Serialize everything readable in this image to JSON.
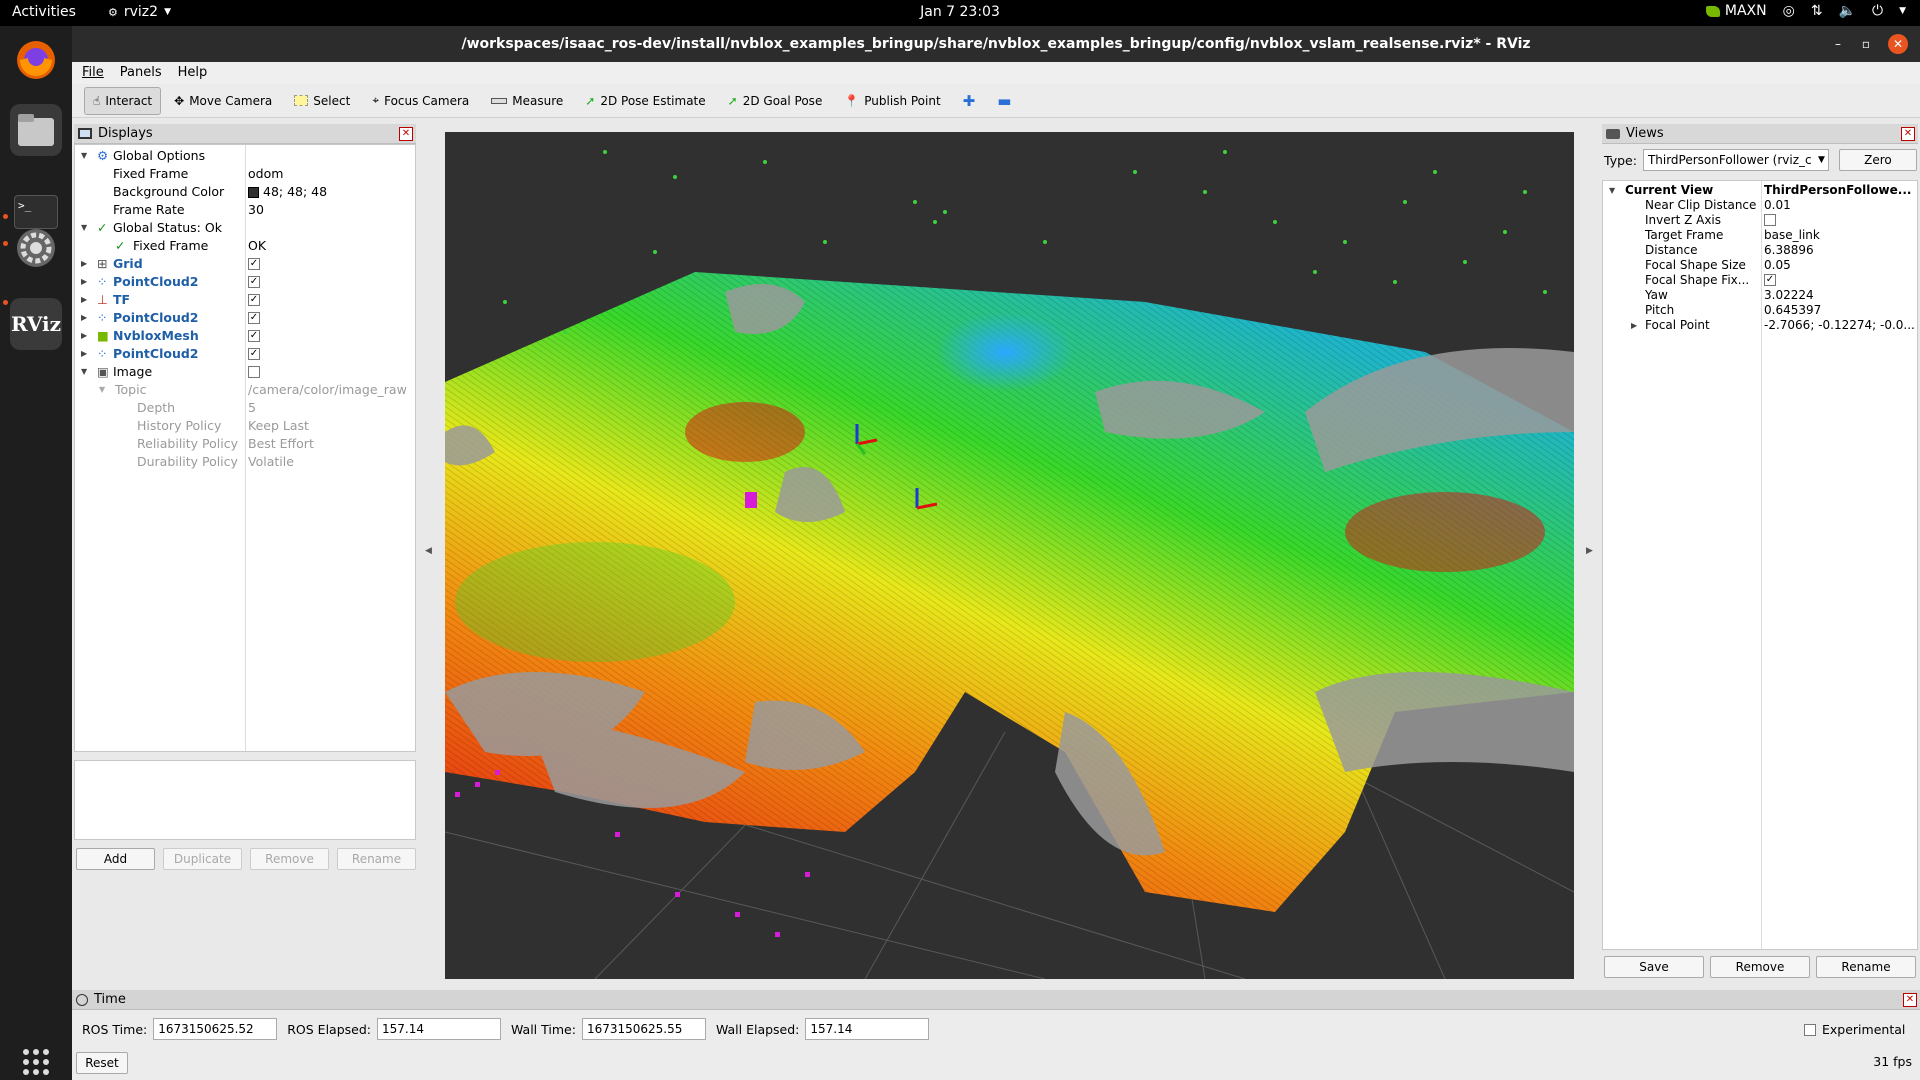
{
  "topbar": {
    "activities": "Activities",
    "app_name": "rviz2",
    "clock": "Jan 7  23:03",
    "power_mode": "MAXN"
  },
  "window": {
    "title": "/workspaces/isaac_ros-dev/install/nvblox_examples_bringup/share/nvblox_examples_bringup/config/nvblox_vslam_realsense.rviz* - RViz"
  },
  "menu": {
    "file": "File",
    "panels": "Panels",
    "help": "Help"
  },
  "toolbar": {
    "interact": "Interact",
    "move_camera": "Move Camera",
    "select": "Select",
    "focus_camera": "Focus Camera",
    "measure": "Measure",
    "pose_estimate": "2D Pose Estimate",
    "goal_pose": "2D Goal Pose",
    "publish_point": "Publish Point"
  },
  "displays": {
    "title": "Displays",
    "global_options": "Global Options",
    "fixed_frame_label": "Fixed Frame",
    "fixed_frame_value": "odom",
    "bg_color_label": "Background Color",
    "bg_color_value": "48; 48; 48",
    "bg_color_swatch": "#303030",
    "frame_rate_label": "Frame Rate",
    "frame_rate_value": "30",
    "global_status": "Global Status: Ok",
    "status_fixed_frame": "Fixed Frame",
    "status_fixed_frame_value": "OK",
    "items": [
      {
        "label": "Grid",
        "checked": true
      },
      {
        "label": "PointCloud2",
        "checked": true
      },
      {
        "label": "TF",
        "checked": true
      },
      {
        "label": "PointCloud2",
        "checked": true
      },
      {
        "label": "NvbloxMesh",
        "checked": true
      },
      {
        "label": "PointCloud2",
        "checked": true
      },
      {
        "label": "Image",
        "checked": false
      }
    ],
    "topic_label": "Topic",
    "topic_value": "/camera/color/image_raw",
    "depth_label": "Depth",
    "depth_value": "5",
    "history_label": "History Policy",
    "history_value": "Keep Last",
    "reliability_label": "Reliability Policy",
    "reliability_value": "Best Effort",
    "durability_label": "Durability Policy",
    "durability_value": "Volatile",
    "buttons": {
      "add": "Add",
      "duplicate": "Duplicate",
      "remove": "Remove",
      "rename": "Rename"
    }
  },
  "views": {
    "title": "Views",
    "type_label": "Type:",
    "type_value": "ThirdPersonFollower (rviz_c",
    "zero": "Zero",
    "current_view": "Current View",
    "current_view_value": "ThirdPersonFollowe...",
    "props": [
      {
        "k": "Near Clip Distance",
        "v": "0.01"
      },
      {
        "k": "Invert Z Axis",
        "v": ""
      },
      {
        "k": "Target Frame",
        "v": "base_link"
      },
      {
        "k": "Distance",
        "v": "6.38896"
      },
      {
        "k": "Focal Shape Size",
        "v": "0.05"
      },
      {
        "k": "Focal Shape Fix...",
        "v": ""
      },
      {
        "k": "Yaw",
        "v": "3.02224"
      },
      {
        "k": "Pitch",
        "v": "0.645397"
      },
      {
        "k": "Focal Point",
        "v": "-2.7066; -0.12274; -0.0..."
      }
    ],
    "invert_z_checked": false,
    "focal_fix_checked": true,
    "buttons": {
      "save": "Save",
      "remove": "Remove",
      "rename": "Rename"
    }
  },
  "time": {
    "title": "Time",
    "ros_time_label": "ROS Time:",
    "ros_time": "1673150625.52",
    "ros_elapsed_label": "ROS Elapsed:",
    "ros_elapsed": "157.14",
    "wall_time_label": "Wall Time:",
    "wall_time": "1673150625.55",
    "wall_elapsed_label": "Wall Elapsed:",
    "wall_elapsed": "157.14",
    "experimental": "Experimental",
    "reset": "Reset",
    "fps": "31 fps"
  }
}
